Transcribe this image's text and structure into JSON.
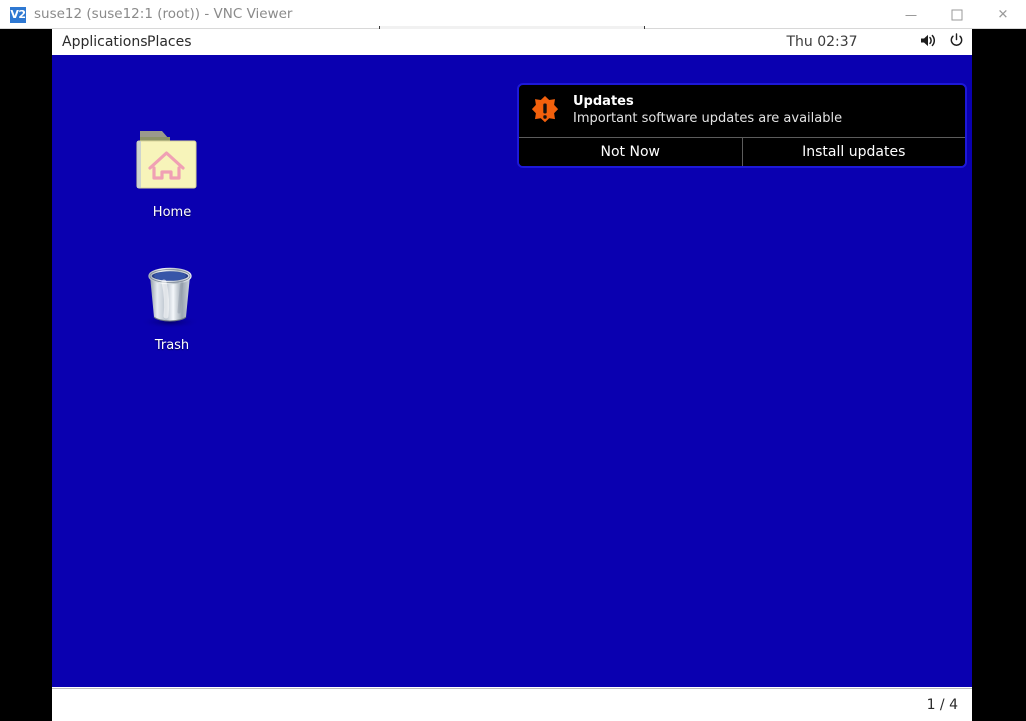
{
  "window": {
    "title": "suse12 (suse12:1 (root)) - VNC Viewer",
    "app_icon_label": "V2",
    "minimize_label": "—",
    "maximize_label": "□",
    "close_label": "✕"
  },
  "panel": {
    "applications_label": "Applications",
    "places_label": "Places",
    "clock": "Thu 02:37",
    "tray": [
      {
        "name": "volume-icon"
      },
      {
        "name": "power-icon"
      }
    ]
  },
  "desktop": {
    "background_color": "#0a00b0",
    "icons": [
      {
        "id": "home",
        "label": "Home",
        "icon": "home-folder-icon"
      },
      {
        "id": "trash",
        "label": "Trash",
        "icon": "trash-can-icon"
      }
    ]
  },
  "notification": {
    "icon": "update-alert-icon",
    "accent_color": "#f2600c",
    "border_color": "#1d18d8",
    "title": "Updates",
    "message": "Important software updates are available",
    "actions": [
      {
        "id": "not-now",
        "label": "Not Now"
      },
      {
        "id": "install-updates",
        "label": "Install updates"
      }
    ]
  },
  "statusbar": {
    "page_indicator": "1 / 4"
  }
}
